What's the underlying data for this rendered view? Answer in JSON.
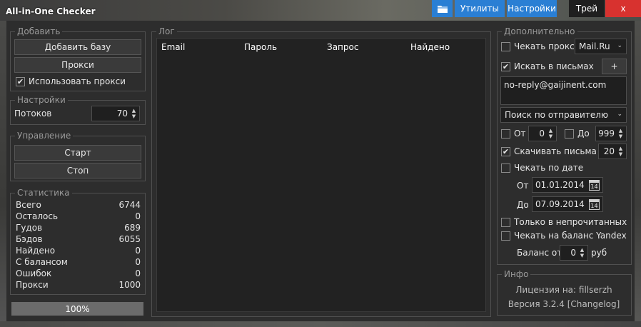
{
  "window": {
    "title": "All-in-One Checker",
    "toolbar": {
      "folder_icon": "folder-icon",
      "utilities_label": "Утилиты",
      "settings_label": "Настройки",
      "tray_label": "Трей",
      "close_label": "x"
    }
  },
  "add_group": {
    "legend": "Добавить",
    "add_base_label": "Добавить базу",
    "proxy_label": "Прокси",
    "use_proxy_label": "Использовать прокси",
    "use_proxy_checked": true
  },
  "settings_group": {
    "legend": "Настройки",
    "threads_label": "Потоков",
    "threads_value": "70"
  },
  "control_group": {
    "legend": "Управление",
    "start_label": "Старт",
    "stop_label": "Стоп"
  },
  "stats_group": {
    "legend": "Статистика",
    "rows": [
      {
        "label": "Всего",
        "value": "6744"
      },
      {
        "label": "Осталось",
        "value": "0"
      },
      {
        "label": "Гудов",
        "value": "689"
      },
      {
        "label": "Бэдов",
        "value": "6055"
      },
      {
        "label": "Найдено",
        "value": "0"
      },
      {
        "label": "С балансом",
        "value": "0"
      },
      {
        "label": "Ошибок",
        "value": "0"
      },
      {
        "label": "Прокси",
        "value": "1000"
      }
    ]
  },
  "progress": {
    "label": "100%",
    "fraction": 1.0
  },
  "log": {
    "legend": "Лог",
    "columns": [
      "Email",
      "Пароль",
      "Запрос",
      "Найдено"
    ]
  },
  "extra": {
    "legend": "Дополнительно",
    "check_proxy_label": "Чекать прокси",
    "check_proxy_checked": false,
    "proxy_service_value": "Mail.Ru",
    "search_in_mail_label": "Искать в письмах",
    "search_in_mail_checked": true,
    "add_label": "+",
    "search_text": "no-reply@gaijinent.com",
    "search_mode_value": "Поиск по отправителю",
    "from_label": "От",
    "from_checked": false,
    "from_value": "0",
    "to_label": "До",
    "to_checked": false,
    "to_value": "999",
    "download_label": "Скачивать письма",
    "download_checked": true,
    "download_value": "20",
    "check_by_date_label": "Чекать по дате",
    "check_by_date_checked": false,
    "date_from_label": "От",
    "date_from_value": "01.01.2014",
    "date_to_label": "До",
    "date_to_value": "07.09.2014",
    "calendar_day": "14",
    "unread_only_label": "Только в непрочитанных",
    "unread_only_checked": false,
    "yandex_balance_label": "Чекать на баланс Yandex",
    "yandex_balance_checked": false,
    "balance_from_label": "Баланс от",
    "balance_value": "0",
    "balance_unit": "руб"
  },
  "info": {
    "legend": "Инфо",
    "license_text": "Лицензия на: fillserzh",
    "version_text": "Версия 3.2.4 [Changelog]"
  }
}
